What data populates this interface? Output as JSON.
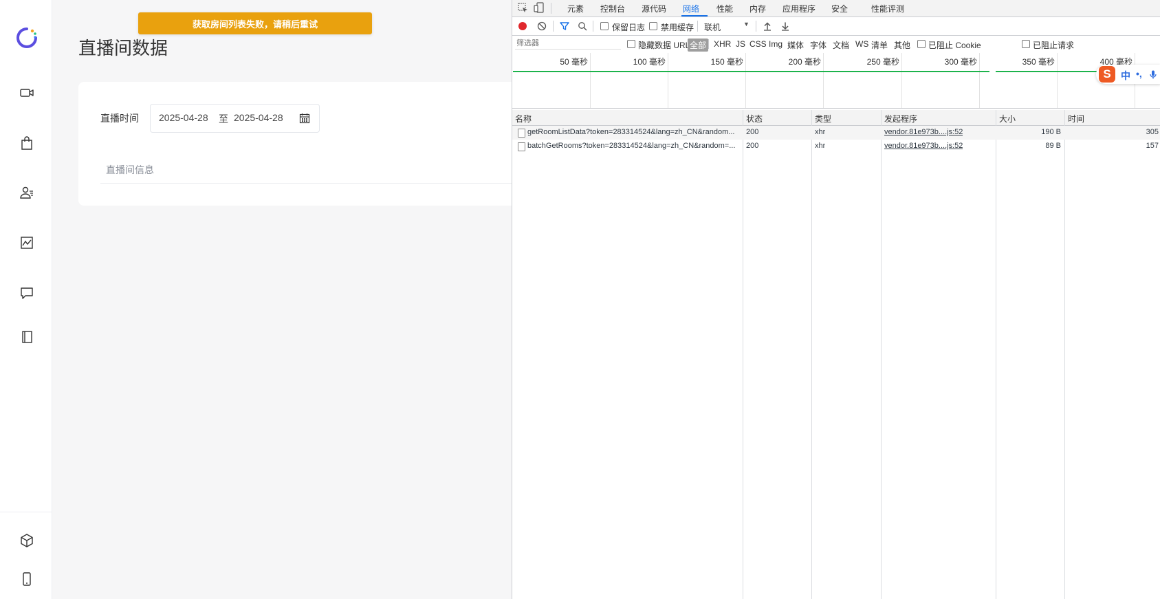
{
  "toast": {
    "message": "获取房间列表失败，请稍后重试"
  },
  "page": {
    "title": "直播间数据",
    "filter": {
      "label": "直播时间",
      "start_date": "2025-04-28",
      "separator": "至",
      "end_date": "2025-04-28"
    },
    "info_tab": "直播间信息"
  },
  "sidebar": {
    "items": [
      "video-camera-icon",
      "shopping-bag-icon",
      "user-list-icon",
      "chart-icon",
      "message-icon",
      "book-icon"
    ],
    "bottom_items": [
      "cube-icon",
      "mobile-icon"
    ]
  },
  "devtools": {
    "tabs": [
      {
        "label": "元素"
      },
      {
        "label": "控制台"
      },
      {
        "label": "源代码"
      },
      {
        "label": "网络"
      },
      {
        "label": "性能"
      },
      {
        "label": "内存"
      },
      {
        "label": "应用程序"
      },
      {
        "label": "安全"
      },
      {
        "label": "性能评测"
      }
    ],
    "active_tab": "网络",
    "toolbar": {
      "preserve_log": "保留日志",
      "disable_cache": "禁用缓存",
      "throttle": "联机"
    },
    "filter_bar": {
      "placeholder": "筛选器",
      "hide_data_url": "隐藏数据 URL",
      "types": [
        "全部",
        "XHR",
        "JS",
        "CSS",
        "Img",
        "媒体",
        "字体",
        "文档",
        "WS",
        "清单",
        "其他"
      ],
      "active_type": "全部",
      "blocked_cookies": "已阻止 Cookie",
      "blocked_requests": "已阻止请求"
    },
    "timeline_labels": [
      "50 毫秒",
      "100 毫秒",
      "150 毫秒",
      "200 毫秒",
      "250 毫秒",
      "300 毫秒",
      "350 毫秒",
      "400 毫秒"
    ],
    "columns": [
      "名称",
      "状态",
      "类型",
      "发起程序",
      "大小",
      "时间"
    ],
    "requests": [
      {
        "name": "getRoomListData?token=283314524&lang=zh_CN&random...",
        "status": "200",
        "type": "xhr",
        "initiator": "vendor.81e973b....js:52",
        "size": "190 B",
        "time": "305"
      },
      {
        "name": "batchGetRooms?token=283314524&lang=zh_CN&random=...",
        "status": "200",
        "type": "xhr",
        "initiator": "vendor.81e973b....js:52",
        "size": "89 B",
        "time": "157"
      }
    ]
  },
  "ime": {
    "logo": "S",
    "lang": "中",
    "punct": "•,"
  },
  "colors": {
    "toast": "#e9a10e",
    "accent": "#1a73e8",
    "record": "#e0282d",
    "timeline_green": "#1db34b"
  }
}
